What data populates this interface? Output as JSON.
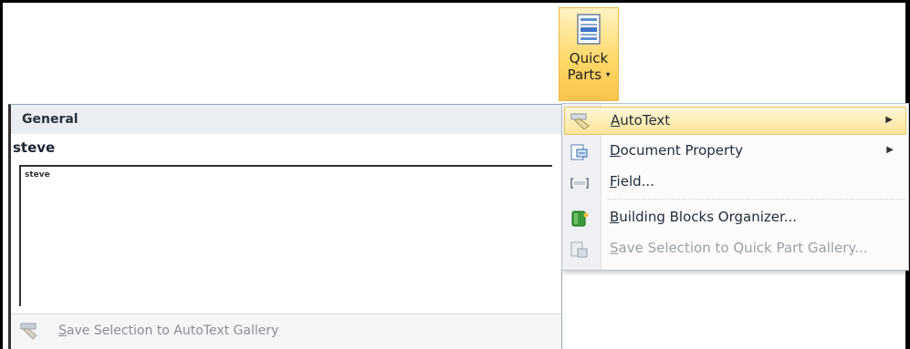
{
  "ribbon": {
    "quick_parts": {
      "line1": "Quick",
      "line2": "Parts",
      "dropdown_arrow": "▾"
    }
  },
  "autotext_gallery": {
    "category": "General",
    "entry_name": "steve",
    "preview_text": "steve",
    "footer": {
      "save_label_first": "S",
      "save_label_rest": "ave Selection to AutoText Gallery"
    }
  },
  "quick_parts_menu": {
    "items": [
      {
        "icon": "autotext-icon",
        "label_first": "A",
        "label_rest": "utoText",
        "has_submenu": true,
        "highlighted": true,
        "disabled": false
      },
      {
        "icon": "document-property-icon",
        "label_first": "D",
        "label_rest": "ocument Property",
        "has_submenu": true,
        "highlighted": false,
        "disabled": false
      },
      {
        "icon": "field-icon",
        "label_first": "F",
        "label_rest": "ield...",
        "has_submenu": false,
        "highlighted": false,
        "disabled": false
      },
      {
        "icon": "building-blocks-icon",
        "label_first": "B",
        "label_rest": "uilding Blocks Organizer...",
        "has_submenu": false,
        "highlighted": false,
        "disabled": false
      },
      {
        "icon": "save-to-gallery-icon",
        "label_first": "S",
        "label_rest": "ave Selection to Quick Part Gallery...",
        "has_submenu": false,
        "highlighted": false,
        "disabled": true
      }
    ],
    "submenu_arrow": "▶"
  }
}
